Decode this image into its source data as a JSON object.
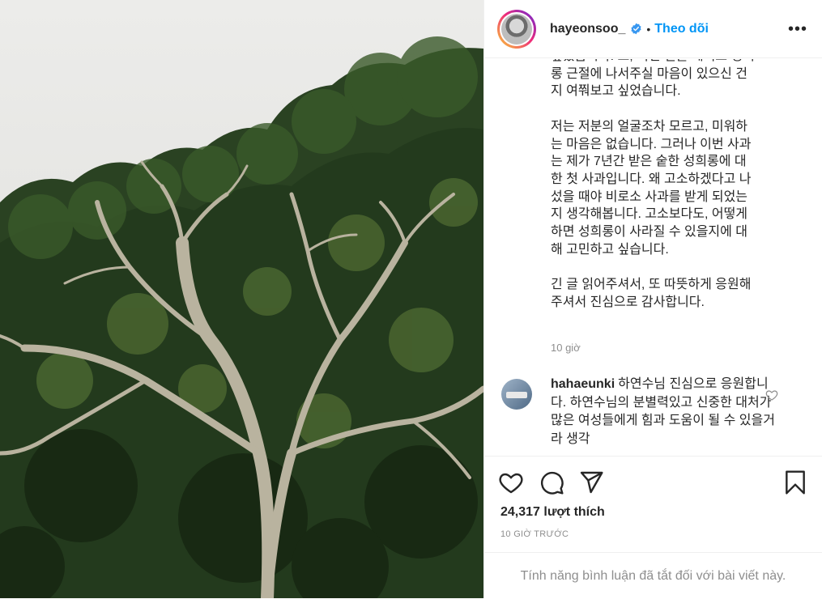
{
  "post": {
    "username": "hayeonsoo_",
    "follow_label": "Theo dõi",
    "separator": "•",
    "more_label": "•••",
    "caption": "싶었습니다. 또, 이번 일을 계기로 성희\n롱 근절에 나서주실 마음이 있으신 건\n지 여쭤보고 싶었습니다.\n\n저는 저분의 얼굴조차 모르고, 미워하\n는 마음은 없습니다. 그러나 이번 사과\n는 제가 7년간 받은 숱한 성희롱에 대\n한 첫 사과입니다. 왜 고소하겠다고 나\n섰을 때야 비로소 사과를 받게 되었는\n지 생각해봅니다. 고소보다도, 어떻게\n하면 성희롱이 사라질 수 있을지에 대\n해 고민하고 싶습니다.\n\n긴 글 읽어주셔서, 또 따뜻하게 응원해\n주셔서 진심으로 감사합니다.",
    "caption_time": "10 giờ",
    "comment": {
      "username": "hahaeunki",
      "text": "하연수님 진심으로 응원합니다. 하연수님의 분별력있고 신중한 대처가 많은 여성들에게 힘과 도움이 될 수 있을거라 생각"
    },
    "likes": "24,317 lượt thích",
    "date": "10 GIỜ TRƯỚC",
    "comments_disabled": "Tính năng bình luận đã tắt đối với bài viết này."
  },
  "icons": {
    "verified": "verified-badge-icon",
    "like": "heart-icon",
    "comment": "comment-icon",
    "share": "share-icon",
    "save": "bookmark-icon"
  },
  "colors": {
    "accent": "#0095f6",
    "verified": "#3897f0",
    "muted": "#8e8e8e",
    "text": "#262626"
  }
}
